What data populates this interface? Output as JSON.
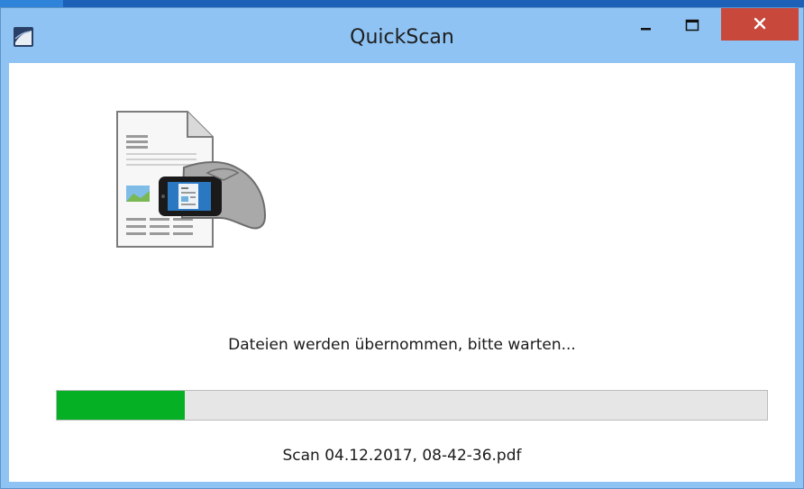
{
  "window": {
    "title": "QuickScan",
    "app_icon": "quickscan-app-icon",
    "controls": {
      "minimize_icon": "minimize-icon",
      "maximize_icon": "maximize-icon",
      "close_icon": "close-icon"
    }
  },
  "content": {
    "illustration_icon": "document-scan-phone-icon",
    "status_text": "Dateien werden übernommen, bitte warten...",
    "progress_percent": 18,
    "filename": "Scan 04.12.2017, 08-42-36.pdf"
  },
  "colors": {
    "titlebar": "#8fc3f3",
    "close_button": "#c9483c",
    "progress_fill": "#06b025",
    "progress_track": "#e6e6e6"
  }
}
